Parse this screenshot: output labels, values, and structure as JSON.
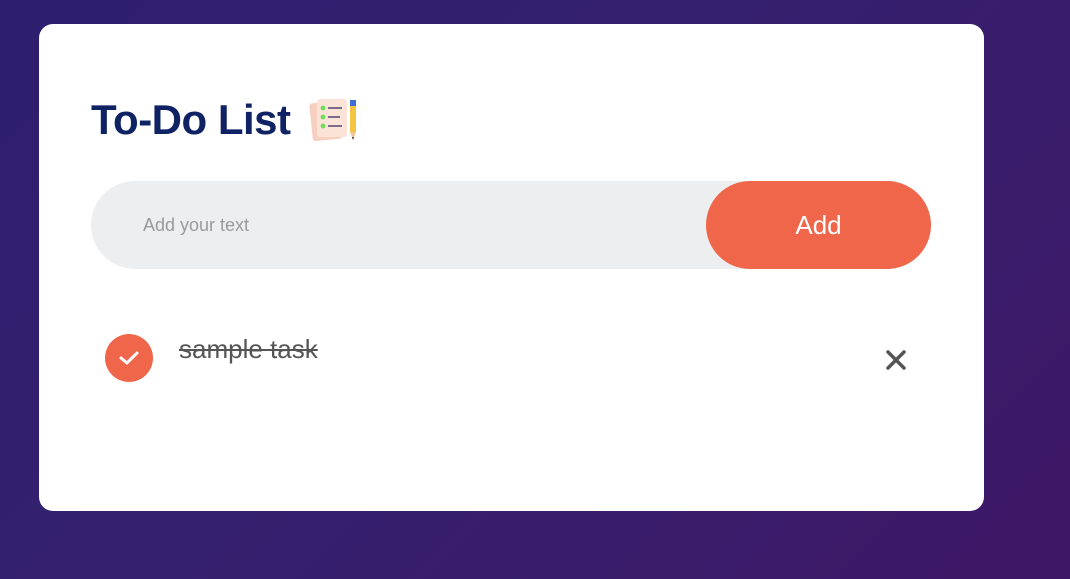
{
  "header": {
    "title": "To-Do List",
    "title_icon": "notepad-pencil-icon"
  },
  "form": {
    "input_value": "",
    "input_placeholder": "Add your text",
    "add_label": "Add"
  },
  "tasks": [
    {
      "text": "sample task",
      "completed": true,
      "check_icon": "checkmark-icon",
      "delete_icon": "close-icon"
    }
  ],
  "colors": {
    "accent": "#f0664a",
    "title": "#0f2364",
    "input_bg": "#edeef0",
    "background": "#35206f",
    "task_text": "#555555"
  }
}
